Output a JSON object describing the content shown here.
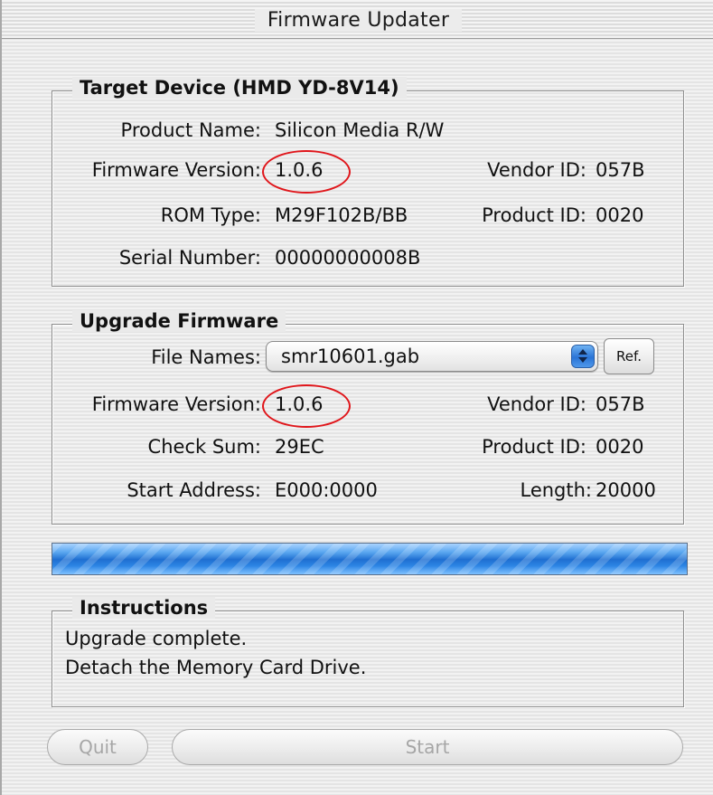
{
  "window": {
    "title": "Firmware Updater"
  },
  "target_device": {
    "group_title": "Target Device (HMD YD-8V14)",
    "product_name_label": "Product Name:",
    "product_name": "Silicon Media R/W",
    "firmware_version_label": "Firmware Version:",
    "firmware_version": "1.0.6",
    "vendor_id_label": "Vendor ID:",
    "vendor_id": "057B",
    "rom_type_label": "ROM Type:",
    "rom_type": "M29F102B/BB",
    "product_id_label": "Product ID:",
    "product_id": "0020",
    "serial_number_label": "Serial Number:",
    "serial_number": "00000000008B"
  },
  "upgrade_firmware": {
    "group_title": "Upgrade Firmware",
    "file_names_label": "File Names:",
    "file_name_selected": "smr10601.gab",
    "ref_button_label": "Ref.",
    "firmware_version_label": "Firmware Version:",
    "firmware_version": "1.0.6",
    "vendor_id_label": "Vendor ID:",
    "vendor_id": "057B",
    "check_sum_label": "Check Sum:",
    "check_sum": "29EC",
    "product_id_label": "Product ID:",
    "product_id": "0020",
    "start_address_label": "Start Address:",
    "start_address": "E000:0000",
    "length_label": "Length:",
    "length": "20000"
  },
  "progress": {
    "fraction": 1.0
  },
  "instructions": {
    "group_title": "Instructions",
    "lines": [
      "Upgrade complete.",
      "Detach the Memory Card Drive."
    ]
  },
  "buttons": {
    "quit_label": "Quit",
    "start_label": "Start"
  },
  "annotation": {
    "circle_color": "#e0161b"
  },
  "colors": {
    "progress_blue": "#1f6fd1",
    "popup_arrow_blue": "#2a74d6"
  },
  "icons": {
    "popup_arrows": "up-down-arrows-icon"
  }
}
